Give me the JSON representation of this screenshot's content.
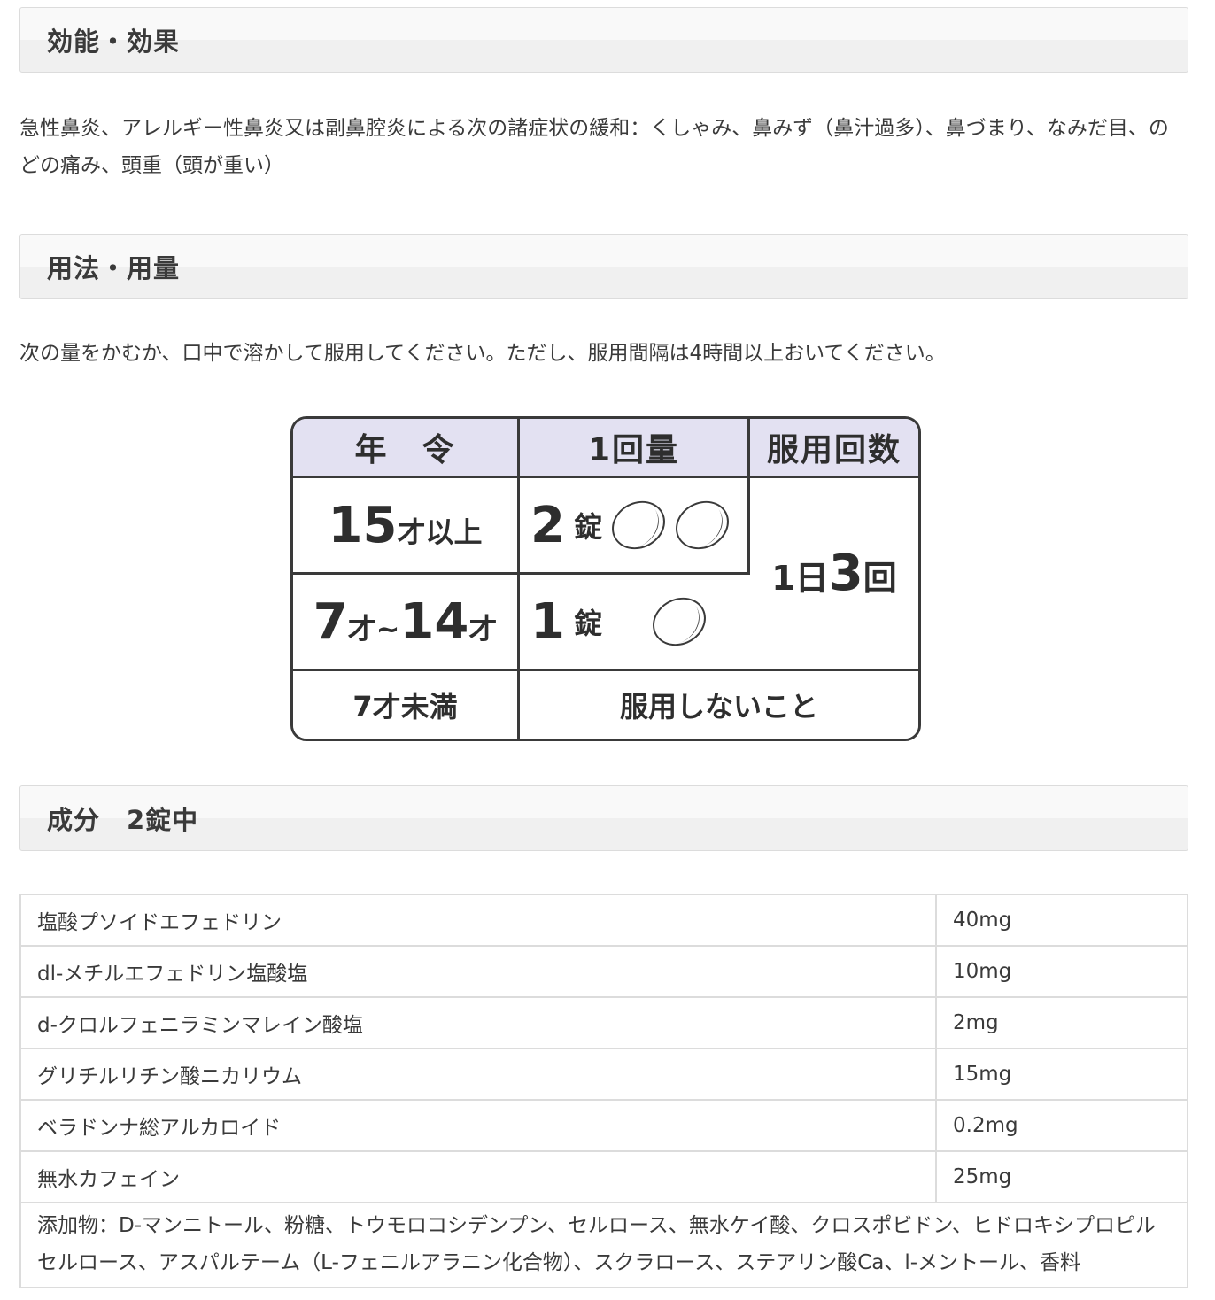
{
  "efficacy": {
    "heading": "効能・効果",
    "text": "急性鼻炎、アレルギー性鼻炎又は副鼻腔炎による次の諸症状の緩和：くしゃみ、鼻みず（鼻汁過多）、鼻づまり、なみだ目、のどの痛み、頭重（頭が重い）"
  },
  "usage": {
    "heading": "用法・用量",
    "text": "次の量をかむか、口中で溶かして服用してください。ただし、服用間隔は4時間以上おいてください。",
    "table": {
      "headers": [
        "年　令",
        "1回量",
        "服用回数"
      ],
      "rows": [
        {
          "age_num": "15",
          "age_unit": "才以上",
          "dose_num": "2",
          "dose_unit": "錠",
          "tablets": 2
        },
        {
          "age_num": "7",
          "age_unit": "才~",
          "age_num2": "14",
          "age_unit2": "才",
          "dose_num": "1",
          "dose_unit": "錠",
          "tablets": 1
        }
      ],
      "frequency": {
        "prefix": "1日",
        "num": "3",
        "suffix": "回"
      },
      "last_row": {
        "age": "7才未満",
        "note": "服用しないこと"
      }
    }
  },
  "ingredients": {
    "heading": "成分　2錠中",
    "rows": [
      {
        "name": "塩酸プソイドエフェドリン",
        "amount": "40mg"
      },
      {
        "name": "dl-メチルエフェドリン塩酸塩",
        "amount": "10mg"
      },
      {
        "name": "d-クロルフェニラミンマレイン酸塩",
        "amount": "2mg"
      },
      {
        "name": "グリチルリチン酸ニカリウム",
        "amount": "15mg"
      },
      {
        "name": "ベラドンナ総アルカロイド",
        "amount": "0.2mg"
      },
      {
        "name": "無水カフェイン",
        "amount": "25mg"
      }
    ],
    "additives": "添加物：D-マンニトール、粉糖、トウモロコシデンプン、セルロース、無水ケイ酸、クロスポビドン、ヒドロキシプロピルセルロース、アスパルテーム（L-フェニルアラニン化合物）、スクラロース、ステアリン酸Ca、l-メントール、香料"
  }
}
